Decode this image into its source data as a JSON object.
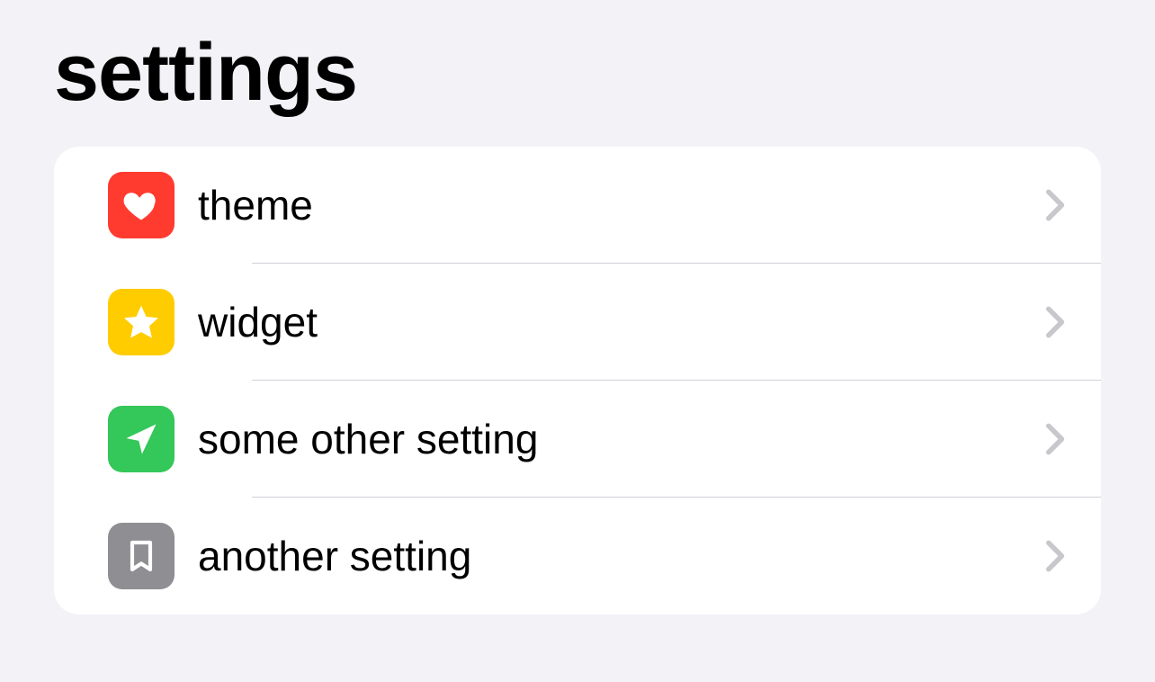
{
  "title": "settings",
  "items": [
    {
      "label": "theme",
      "icon": "heart",
      "color": "#ff3b30"
    },
    {
      "label": "widget",
      "icon": "star",
      "color": "#ffcc00"
    },
    {
      "label": "some other setting",
      "icon": "location-arrow",
      "color": "#34c759"
    },
    {
      "label": "another setting",
      "icon": "bookmark",
      "color": "#8e8e93"
    }
  ]
}
